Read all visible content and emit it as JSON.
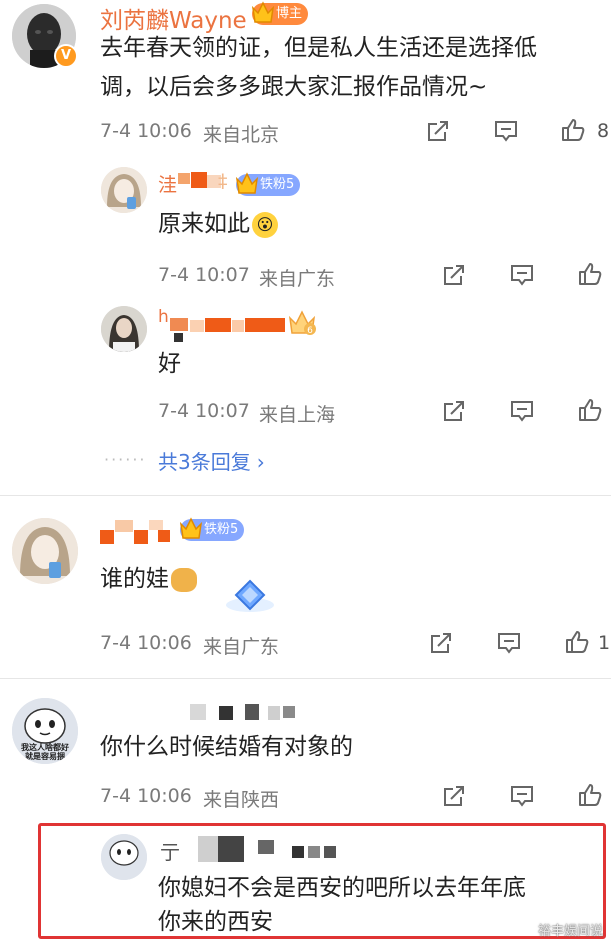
{
  "comments": [
    {
      "name": "刘芮麟Wayne",
      "badge": "博主",
      "text_lines": [
        "去年春天领的证，但是私人生活还是选择低",
        "调，以后会多多跟大家汇报作品情况~"
      ],
      "time": "7-4 10:06",
      "location": "来自北京",
      "like_count": "8",
      "replies": [
        {
          "name_visible": "洼",
          "badge": "铁粉5",
          "text": "原来如此",
          "time": "7-4 10:07",
          "location": "来自广东"
        },
        {
          "name_visible": "h",
          "badge_level": "6",
          "text": "好",
          "time": "7-4 10:07",
          "location": "来自上海"
        }
      ],
      "more_replies": "共3条回复"
    },
    {
      "badge": "铁粉5",
      "text": "谁的娃",
      "time": "7-4 10:06",
      "location": "来自广东",
      "like_count": "1"
    },
    {
      "avatar_caption": [
        "我这人啥都好",
        "就是容易捆"
      ],
      "text": "你什么时候结婚有对象的",
      "time": "7-4 10:06",
      "location": "来自陕西",
      "replies": [
        {
          "name_visible": "亍",
          "text_lines": [
            "你媳妇不会是西安的吧所以去年年底",
            "你来的西安"
          ]
        }
      ]
    }
  ],
  "watermark": "裕丰娱间说",
  "colors": {
    "name": "#eb7340",
    "link": "#4a7ad9",
    "highlight": "#e03434"
  }
}
